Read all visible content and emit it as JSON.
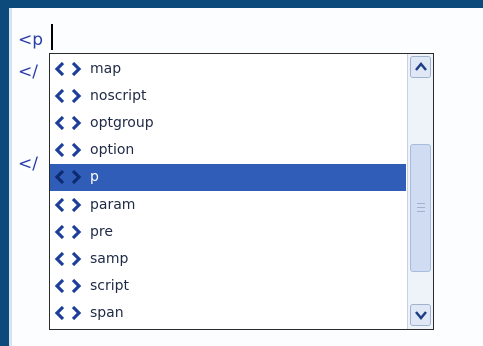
{
  "editor": {
    "line1": "<p",
    "line2": "</",
    "line3": "</"
  },
  "popup": {
    "selected_index": 4,
    "items": [
      {
        "label": "map",
        "icon": "html-tag-icon"
      },
      {
        "label": "noscript",
        "icon": "html-tag-icon"
      },
      {
        "label": "optgroup",
        "icon": "html-tag-icon"
      },
      {
        "label": "option",
        "icon": "html-tag-icon"
      },
      {
        "label": "p",
        "icon": "html-tag-icon"
      },
      {
        "label": "param",
        "icon": "html-tag-icon"
      },
      {
        "label": "pre",
        "icon": "html-tag-icon"
      },
      {
        "label": "samp",
        "icon": "html-tag-icon"
      },
      {
        "label": "script",
        "icon": "html-tag-icon"
      },
      {
        "label": "span",
        "icon": "html-tag-icon"
      }
    ]
  },
  "scrollbar": {
    "up_icon": "chevron-up-icon",
    "down_icon": "chevron-down-icon"
  },
  "colors": {
    "frame": "#0b4a7a",
    "selection": "#2f5db7",
    "tag_icon": "#1d3f9a"
  }
}
